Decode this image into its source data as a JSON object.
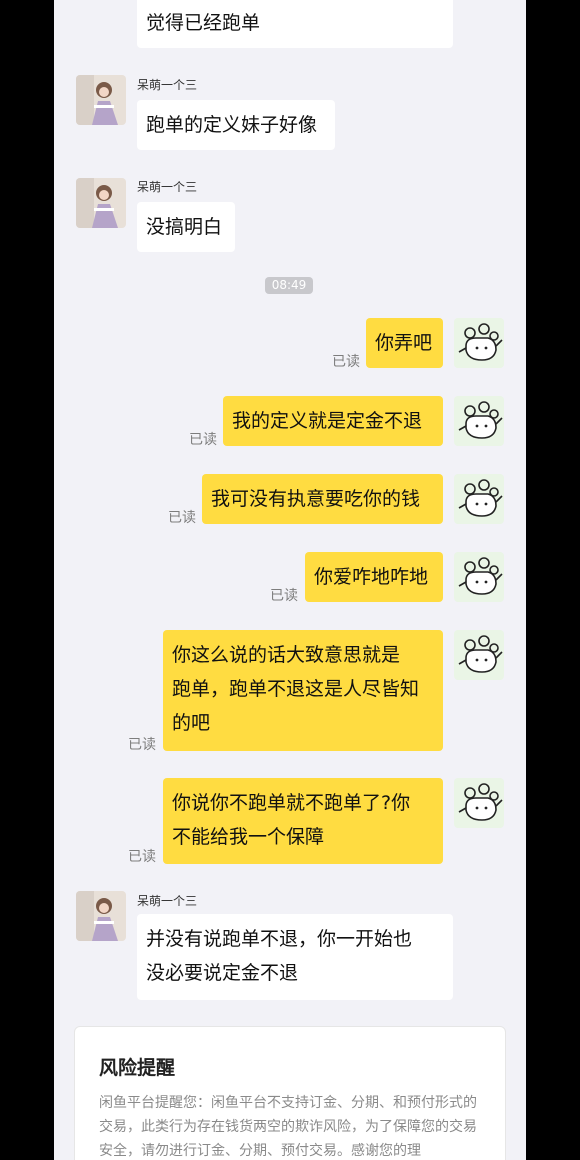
{
  "contact": {
    "name": "呆萌一个三"
  },
  "read_label": "已读",
  "timestamp": "08:49",
  "messages": [
    {
      "id": 0,
      "side": "in",
      "text": "觉得已经跑单"
    },
    {
      "id": 1,
      "side": "in",
      "sender": "呆萌一个三",
      "text": "跑单的定义妹子好像"
    },
    {
      "id": 2,
      "side": "in",
      "sender": "呆萌一个三",
      "text": "没搞明白"
    },
    {
      "id": 3,
      "side": "out",
      "text": "你弄吧",
      "status": "已读"
    },
    {
      "id": 4,
      "side": "out",
      "text": "我的定义就是定金不退",
      "status": "已读"
    },
    {
      "id": 5,
      "side": "out",
      "text": "我可没有执意要吃你的钱",
      "status": "已读"
    },
    {
      "id": 6,
      "side": "out",
      "text": "你爱咋地咋地",
      "status": "已读"
    },
    {
      "id": 7,
      "side": "out",
      "lines": [
        "你这么说的话大致意思就是",
        "跑单，跑单不退这是人尽皆知",
        "的吧"
      ],
      "status": "已读"
    },
    {
      "id": 8,
      "side": "out",
      "lines": [
        "你说你不跑单就不跑单了?你",
        "不能给我一个保障"
      ],
      "status": "已读"
    },
    {
      "id": 9,
      "side": "in",
      "sender": "呆萌一个三",
      "lines": [
        "并没有说跑单不退，你一开始也",
        "没必要说定金不退"
      ]
    }
  ],
  "risk_notice": {
    "title": "风险提醒",
    "body": "闲鱼平台提醒您：闲鱼平台不支持订金、分期、和预付形式的交易，此类行为存在钱货两空的欺诈风险，为了保障您的交易安全，请勿进行订金、分期、预付交易。感谢您的理"
  },
  "colors": {
    "outgoing_bubble": "#ffdc41",
    "incoming_bubble": "#ffffff",
    "background": "#f2f2f7"
  }
}
